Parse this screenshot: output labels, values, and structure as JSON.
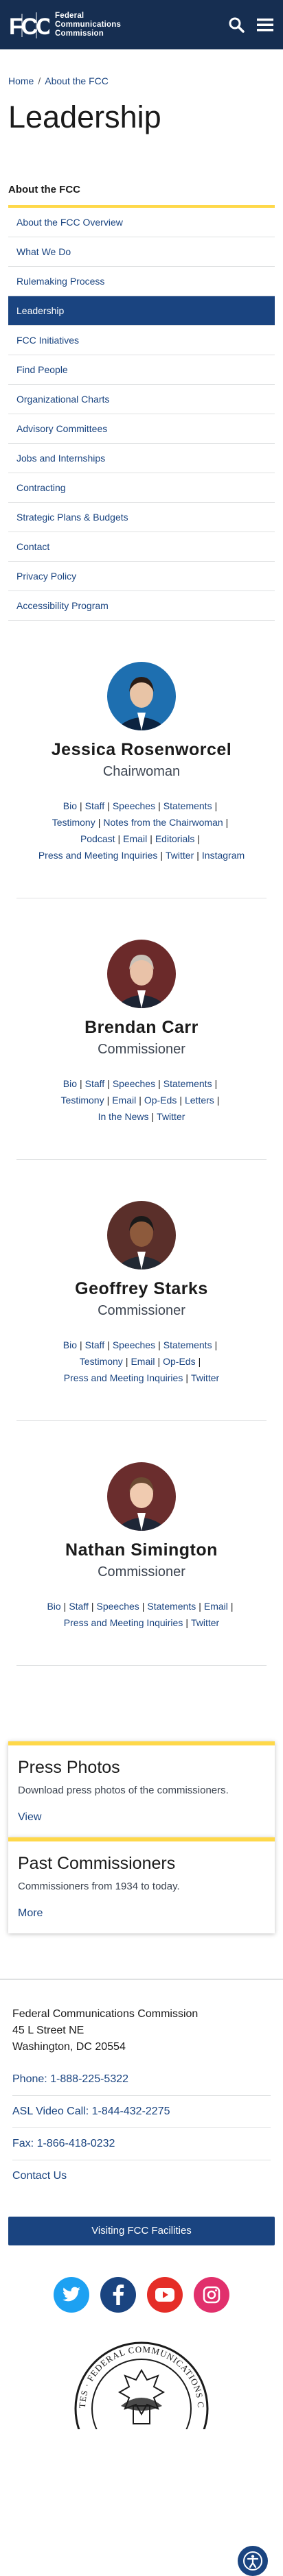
{
  "header": {
    "logo_lines": [
      "Federal",
      "Communications",
      "Commission"
    ],
    "logo_mark": "FCC"
  },
  "breadcrumb": {
    "home": "Home",
    "separator": "/",
    "current": "About the FCC"
  },
  "page_title": "Leadership",
  "side_nav": {
    "title": "About the FCC",
    "items": [
      "About the FCC Overview",
      "What We Do",
      "Rulemaking Process",
      "Leadership",
      "FCC Initiatives",
      "Find People",
      "Organizational Charts",
      "Advisory Committees",
      "Jobs and Internships",
      "Contracting",
      "Strategic Plans & Budgets",
      "Contact",
      "Privacy Policy",
      "Accessibility Program"
    ],
    "active_index": 3
  },
  "people": [
    {
      "name": "Jessica Rosenworcel",
      "role": "Chairwoman",
      "link_lines": [
        [
          "Bio",
          "Staff",
          "Speeches",
          "Statements"
        ],
        [
          "Testimony",
          "Notes from the Chairwoman"
        ],
        [
          "Podcast",
          "Email",
          "Editorials"
        ],
        [
          "Press and Meeting Inquiries",
          "Twitter",
          "Instagram"
        ]
      ]
    },
    {
      "name": "Brendan Carr",
      "role": "Commissioner",
      "link_lines": [
        [
          "Bio",
          "Staff",
          "Speeches",
          "Statements"
        ],
        [
          "Testimony",
          "Email",
          "Op-Eds",
          "Letters"
        ],
        [
          "In the News",
          "Twitter"
        ]
      ]
    },
    {
      "name": "Geoffrey Starks",
      "role": "Commissioner",
      "link_lines": [
        [
          "Bio",
          "Staff",
          "Speeches",
          "Statements"
        ],
        [
          "Testimony",
          "Email",
          "Op-Eds"
        ],
        [
          "Press and Meeting Inquiries",
          "Twitter"
        ]
      ]
    },
    {
      "name": "Nathan Simington",
      "role": "Commissioner",
      "link_lines": [
        [
          "Bio",
          "Staff",
          "Speeches",
          "Statements",
          "Email"
        ],
        [
          "Press and Meeting Inquiries",
          "Twitter"
        ]
      ]
    }
  ],
  "cards": [
    {
      "title": "Press Photos",
      "desc": "Download press photos of the commissioners.",
      "link": "View"
    },
    {
      "title": "Past Commissioners",
      "desc": "Commissioners from 1934 to today.",
      "link": "More"
    }
  ],
  "footer": {
    "address": [
      "Federal Communications Commission",
      "45 L Street NE",
      "Washington, DC 20554"
    ],
    "links": [
      "Phone: 1-888-225-5322",
      "ASL Video Call: 1-844-432-2275",
      "Fax: 1-866-418-0232",
      "Contact Us"
    ],
    "visit_button": "Visiting FCC Facilities",
    "social": [
      {
        "icon": "twitter-icon",
        "color": "#1da1f2"
      },
      {
        "icon": "facebook-icon",
        "color": "#1a4480"
      },
      {
        "icon": "youtube-icon",
        "color": "#e52d27"
      },
      {
        "icon": "instagram-icon",
        "color": "#e1306c"
      }
    ],
    "seal_text": "UNITED STATES · FEDERAL COMMUNICATIONS COMMISSION"
  },
  "colors": {
    "navy": "#162e51",
    "link": "#1a4480",
    "accent_gold": "#fed84a",
    "border": "#dfe1e2"
  }
}
